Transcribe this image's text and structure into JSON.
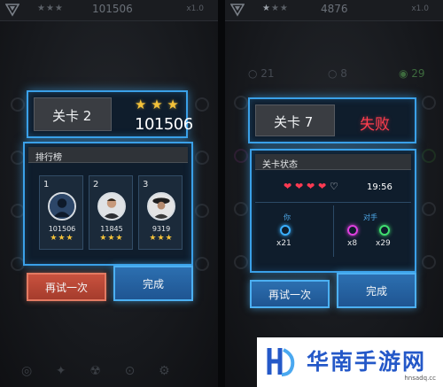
{
  "left": {
    "topbar": {
      "stars": "★★★",
      "score": "101506",
      "multiplier": "x1.0"
    },
    "title": "关卡 2",
    "stars": "★ ★ ★",
    "score": "101506",
    "leaderboard_title": "排行榜",
    "leaderboard": [
      {
        "rank": "1",
        "score": "101506",
        "stars": "★★★"
      },
      {
        "rank": "2",
        "score": "11845",
        "stars": "★★★"
      },
      {
        "rank": "3",
        "score": "9319",
        "stars": "★★★"
      }
    ],
    "retry_label": "再试一次",
    "done_label": "完成"
  },
  "right": {
    "topbar": {
      "stars": "★★★",
      "score": "4876",
      "multiplier": "x1.0"
    },
    "counts": [
      "21",
      "8",
      "29"
    ],
    "title": "关卡 7",
    "result": "失败",
    "status_title": "关卡状态",
    "time": "19:56",
    "you_label": "你",
    "opponent_label": "对手",
    "you_count": "x21",
    "opp_counts": [
      "x8",
      "x29"
    ],
    "retry_label": "再试一次",
    "done_label": "完成"
  },
  "watermark": {
    "text": "华南手游网",
    "url": "hnsadq.cc"
  },
  "colors": {
    "accent": "#3aa0e8",
    "fail": "#ff3e4e",
    "star": "#f3c23a",
    "retry_red": "#c9523f"
  }
}
